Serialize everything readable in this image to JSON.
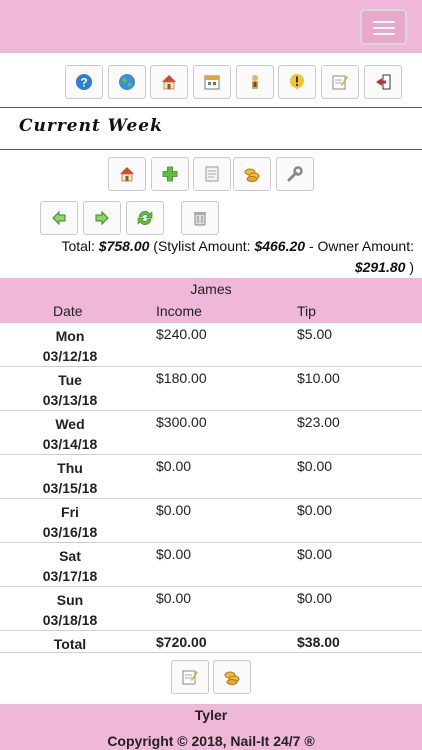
{
  "header": {
    "menu_icon": "hamburger-icon"
  },
  "top_toolbar": [
    {
      "icon": "help-icon",
      "color": "#2a7fd4"
    },
    {
      "icon": "globe-icon",
      "color": "#2a7fd4"
    },
    {
      "icon": "home-icon",
      "color": "#d9432f"
    },
    {
      "icon": "calendar-icon",
      "color": "#e4a531"
    },
    {
      "icon": "person-icon",
      "color": "#e4a531"
    },
    {
      "icon": "alert-icon",
      "color": "#e4a531"
    },
    {
      "icon": "edit-icon",
      "color": "#d9a531"
    },
    {
      "icon": "logout-icon",
      "color": "#c0303a"
    }
  ],
  "section": {
    "title": "Current Week"
  },
  "actions_row1": [
    "home-icon",
    "add-icon",
    "report-icon",
    "coins-icon",
    "wrench-icon"
  ],
  "actions_row2": [
    "prev-week-icon",
    "next-week-icon",
    "refresh-icon",
    "delete-icon"
  ],
  "summary": {
    "total_label": "Total:",
    "total_value": "$758.00",
    "stylist_label": "(Stylist Amount:",
    "stylist_value": "$466.20",
    "owner_label": "- Owner Amount:",
    "owner_value": "$291.80",
    "close": ")"
  },
  "table": {
    "stylist": "James",
    "columns": [
      "Date",
      "Income",
      "Tip"
    ],
    "rows": [
      {
        "day": "Mon",
        "date": "03/12/18",
        "income": "$240.00",
        "tip": "$5.00"
      },
      {
        "day": "Tue",
        "date": "03/13/18",
        "income": "$180.00",
        "tip": "$10.00"
      },
      {
        "day": "Wed",
        "date": "03/14/18",
        "income": "$300.00",
        "tip": "$23.00"
      },
      {
        "day": "Thu",
        "date": "03/15/18",
        "income": "$0.00",
        "tip": "$0.00"
      },
      {
        "day": "Fri",
        "date": "03/16/18",
        "income": "$0.00",
        "tip": "$0.00"
      },
      {
        "day": "Sat",
        "date": "03/17/18",
        "income": "$0.00",
        "tip": "$0.00"
      },
      {
        "day": "Sun",
        "date": "03/18/18",
        "income": "$0.00",
        "tip": "$0.00"
      }
    ],
    "total": {
      "label": "Total",
      "income": "$720.00",
      "tip": "$38.00"
    }
  },
  "bottom_actions": [
    "edit-icon",
    "coins-icon"
  ],
  "footer": {
    "user": "Tyler",
    "copyright": "Copyright © 2018, Nail-It 24/7 ®"
  }
}
